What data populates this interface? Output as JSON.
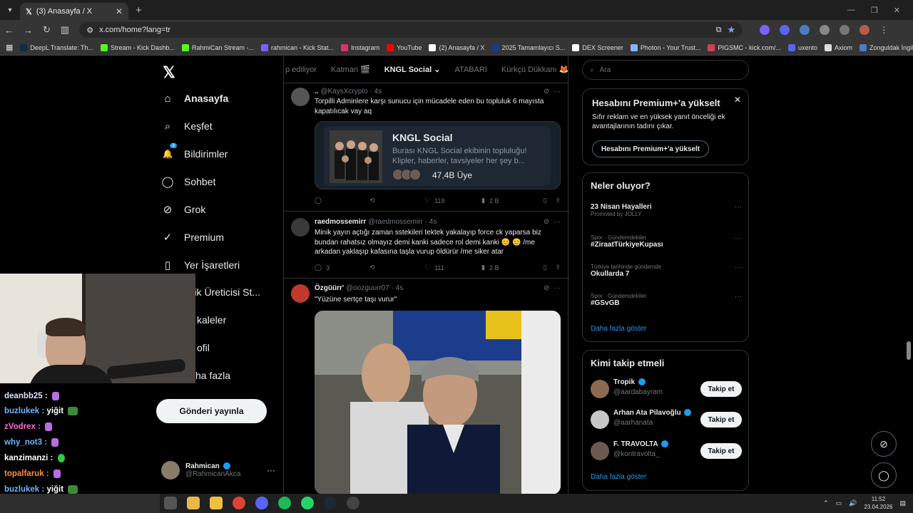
{
  "browser": {
    "tab_title": "(3) Anasayfa / X",
    "url": "x.com/home?lang=tr",
    "bookmarks": [
      {
        "label": "DeepL Translate: Th...",
        "color": "#0f2b46"
      },
      {
        "label": "Stream - Kick Dashb...",
        "color": "#53fc18"
      },
      {
        "label": "RahmiCan Stream -...",
        "color": "#53fc18"
      },
      {
        "label": "rahmican - Kick Stat...",
        "color": "#7b61ff"
      },
      {
        "label": "Instagram",
        "color": "#e1306c"
      },
      {
        "label": "YouTube",
        "color": "#ff0000"
      },
      {
        "label": "(2) Anasayfa / X",
        "color": "#ffffff"
      },
      {
        "label": "2025 Tamamlayıcı S...",
        "color": "#1a3a8a"
      },
      {
        "label": "DEX Screener",
        "color": "#ffffff"
      },
      {
        "label": "Photon - Your Trust...",
        "color": "#8ab4f8"
      },
      {
        "label": "PIGSMC - kick.com/...",
        "color": "#d04060"
      },
      {
        "label": "uxento",
        "color": "#5865f2"
      },
      {
        "label": "Axiom",
        "color": "#dddddd"
      },
      {
        "label": "Zonguldak İngilizce...",
        "color": "#4a7cc4"
      }
    ]
  },
  "nav": {
    "items": [
      {
        "label": "Anasayfa",
        "icon": "home-icon",
        "glyph": "⌂"
      },
      {
        "label": "Keşfet",
        "icon": "search-icon",
        "glyph": "⌕"
      },
      {
        "label": "Bildirimler",
        "icon": "bell-icon",
        "glyph": "🔔"
      },
      {
        "label": "Sohbet",
        "icon": "chat-icon",
        "glyph": "◯"
      },
      {
        "label": "Grok",
        "icon": "grok-icon",
        "glyph": "⊘"
      },
      {
        "label": "Premium",
        "icon": "premium-icon",
        "glyph": "✓"
      },
      {
        "label": "Yer İşaretleri",
        "icon": "bookmark-icon",
        "glyph": "▯"
      },
      {
        "label": "erik Üreticisi St...",
        "icon": "",
        "glyph": ""
      },
      {
        "label": "kaleler",
        "icon": "",
        "glyph": ""
      },
      {
        "label": "ofil",
        "icon": "",
        "glyph": ""
      },
      {
        "label": "ha fazla",
        "icon": "",
        "glyph": ""
      }
    ],
    "notif_count": "3",
    "post_button": "Gönderi yayınla",
    "profile_name": "Rahmican",
    "profile_handle": "@RahmicanAkca"
  },
  "chat": [
    {
      "user": "deanbb25 :",
      "msg": "",
      "color": "#d6e4ff",
      "emote": "#b86ee0"
    },
    {
      "user": "buzlukek :",
      "msg": "yiğit",
      "color": "#6fb5ff",
      "emote": "#3c8a3a"
    },
    {
      "user": "zVodrex :",
      "msg": "",
      "color": "#ff6ad5",
      "emote": "#b86ee0"
    },
    {
      "user": "why_not3 :",
      "msg": "",
      "color": "#6fb5ff",
      "emote": "#b86ee0"
    },
    {
      "user": "kanzimanzi :",
      "msg": "",
      "color": "#ffffff",
      "emote": "#2ecc40"
    },
    {
      "user": "topalfaruk :",
      "msg": "",
      "color": "#ff8c42",
      "emote": "#b86ee0"
    },
    {
      "user": "buzlukek :",
      "msg": "yiğit",
      "color": "#6fb5ff",
      "emote": "#3c8a3a"
    }
  ],
  "feed": {
    "tabs": [
      "p ediliyor",
      "Katman 🎬",
      "KNGL Social",
      "ATABARI",
      "Kürkçü Dükkanı 🦊"
    ],
    "active_tab": "KNGL Social",
    "posts": [
      {
        "name": "..",
        "handle": "@KaysXcrypto · 4s",
        "text": "Torpilli Adminlere karşı sunucu için mücadele eden bu topluluk 6 mayısta kapatılıcak vay aq",
        "card_title": "KNGL Social",
        "card_desc": "Burası KNGL Social ekibinin topluluğu! Klipler, haberler, tavsiyeler her şey b...",
        "card_members": "47,4B Üye",
        "replies": "",
        "reposts": "",
        "likes": "119",
        "views": "2 B"
      },
      {
        "name": "raedmossemirr",
        "handle": "@raedmossemirr · 4s",
        "text": "Minik yayın açtığı zaman sstekileri tektek yakalayıp force ck yaparsa biz bundan rahatsız olmayız demi kanki sadece rol demi kanki 😊 😊 /me arkadan yaklaşıp kafasına taşla vurup öldürür /me siker atar",
        "replies": "3",
        "reposts": "",
        "likes": "111",
        "views": "2 B"
      },
      {
        "name": "Özgüürr'",
        "handle": "@oozguurr07 · 4s",
        "text": "\"Yüzüne sertçe taşı vurur\""
      }
    ]
  },
  "right": {
    "search_placeholder": "Ara",
    "premium_title": "Hesabını Premium+'a yükselt",
    "premium_text": "Sıfır reklam ve en yüksek yanıt önceliği ek avantajlarının tadını çıkar.",
    "premium_button": "Hesabını Premium+'a yükselt",
    "trends_title": "Neler oluyor?",
    "trends": [
      {
        "meta": "",
        "name": "23 Nisan Hayalleri",
        "sub": "Promoted by JOLLY"
      },
      {
        "meta": "Spor · Gündemdekiler",
        "name": "#ZiraatTürkiyeKupası",
        "sub": ""
      },
      {
        "meta": "Türkiye tarihinde gündemde",
        "name": "Okullarda 7",
        "sub": ""
      },
      {
        "meta": "Spor · Gündemdekiler",
        "name": "#GSvGB",
        "sub": ""
      }
    ],
    "show_more": "Daha fazla göster",
    "follow_title": "Kimi takip etmeli",
    "follows": [
      {
        "name": "Tropik",
        "handle": "@aardabayram",
        "button": "Takip et",
        "color": "#8a6a50"
      },
      {
        "name": "Arhan Ata Pilavoğlu",
        "handle": "@aarhanata",
        "button": "Takip et",
        "color": "#c8c8c8"
      },
      {
        "name": "F. TRAVOLTA",
        "handle": "@kontravolta_",
        "button": "Takip et",
        "color": "#6a5a50"
      }
    ],
    "show_more_2": "Daha fazla göster"
  },
  "taskbar": {
    "time": "11:52",
    "date": "23.04.2026"
  }
}
